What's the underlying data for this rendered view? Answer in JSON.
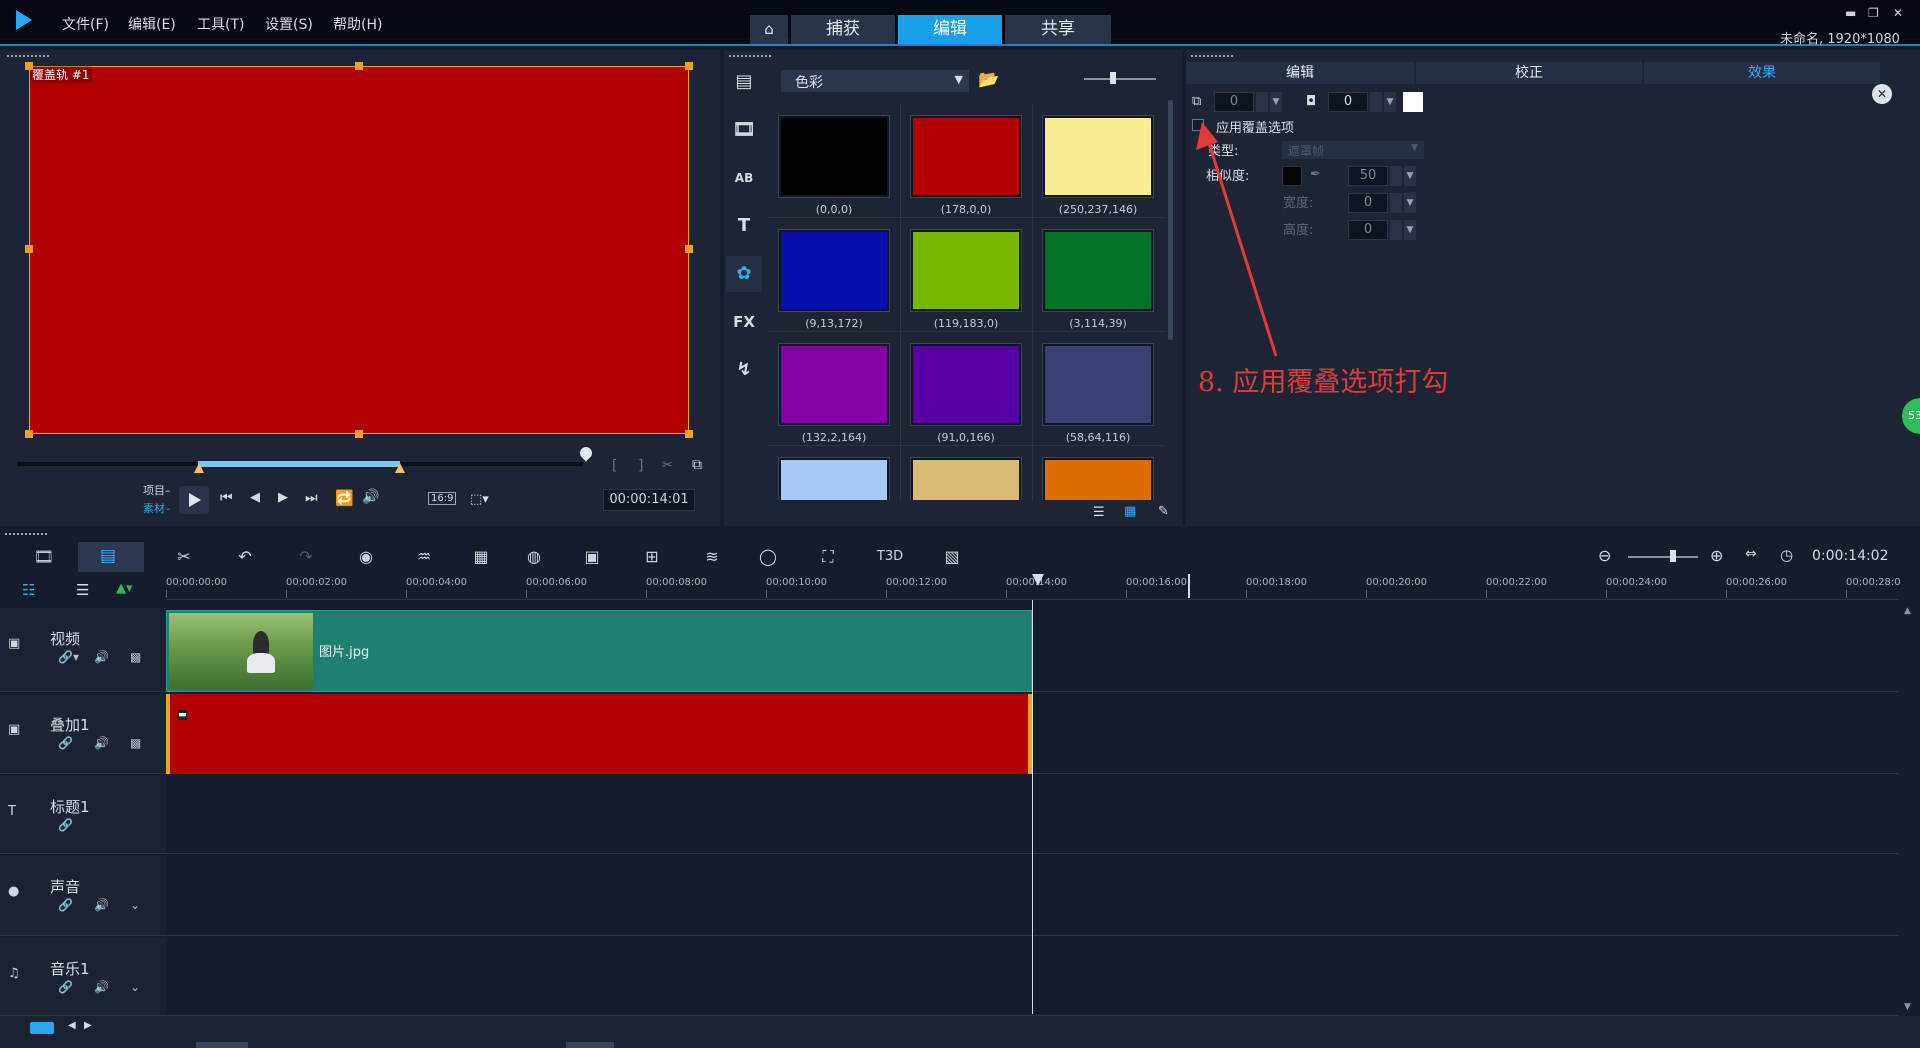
{
  "menu": [
    "文件(F)",
    "编辑(E)",
    "工具(T)",
    "设置(S)",
    "帮助(H)"
  ],
  "tabs": {
    "home_icon": "home-icon",
    "capture": "捕获",
    "edit": "编辑",
    "share": "共享"
  },
  "window": {
    "project_info": "未命名, 1920*1080"
  },
  "preview": {
    "overlay_label": "覆盖轨 #1",
    "fill_color": "#b20000",
    "project_label": "项目",
    "clip_label": "素材",
    "aspect": "16:9",
    "timecode": "00:00:14:01"
  },
  "library": {
    "category": "色彩",
    "swatches": [
      {
        "color": "#000000",
        "label": "(0,0,0)"
      },
      {
        "color": "#b20000",
        "label": "(178,0,0)"
      },
      {
        "color": "#faed92",
        "label": "(250,237,146)"
      },
      {
        "color": "#090dac",
        "label": "(9,13,172)"
      },
      {
        "color": "#77b700",
        "label": "(119,183,0)"
      },
      {
        "color": "#037227",
        "label": "(3,114,39)"
      },
      {
        "color": "#8402a4",
        "label": "(132,2,164)"
      },
      {
        "color": "#5b00a6",
        "label": "(91,0,166)"
      },
      {
        "color": "#3a4074",
        "label": "(58,64,116)"
      },
      {
        "color": "#a8c8f8",
        "label": ""
      },
      {
        "color": "#d9bb74",
        "label": ""
      },
      {
        "color": "#e06c06",
        "label": ""
      }
    ]
  },
  "options": {
    "tabs": [
      "编辑",
      "校正",
      "效果"
    ],
    "active_tab": "效果",
    "value1": "0",
    "value2": "0",
    "apply_overlay_label": "应用覆盖选项",
    "type_label": "类型:",
    "type_value": "遮罩帧",
    "similarity_label": "相似度:",
    "similarity_value": "50",
    "width_label": "宽度:",
    "width_value": "0",
    "height_label": "高度:",
    "height_value": "0",
    "annotation": "8. 应用覆叠选项打勾",
    "annotation_color": "#e03a3a",
    "badge": "53"
  },
  "timeline": {
    "timecode": "0:00:14:02",
    "ruler": [
      "00:00:00:00",
      "00:00:02:00",
      "00:00:04:00",
      "00:00:06:00",
      "00:00:08:00",
      "00:00:10:00",
      "00:00:12:00",
      "00:00:14:00",
      "00:00:16:00",
      "00:00:18:00",
      "00:00:20:00",
      "00:00:22:00",
      "00:00:24:00",
      "00:00:26:00",
      "00:00:28:0"
    ],
    "tracks": [
      {
        "name": "视频",
        "icon": "video-track-icon"
      },
      {
        "name": "叠加1",
        "icon": "overlay-track-icon"
      },
      {
        "name": "标题1",
        "icon": "title-track-icon"
      },
      {
        "name": "声音",
        "icon": "voice-track-icon"
      },
      {
        "name": "音乐1",
        "icon": "music-track-icon"
      }
    ],
    "video_clip_name": "图片.jpg",
    "overlay_clip_color": "#b20000"
  }
}
